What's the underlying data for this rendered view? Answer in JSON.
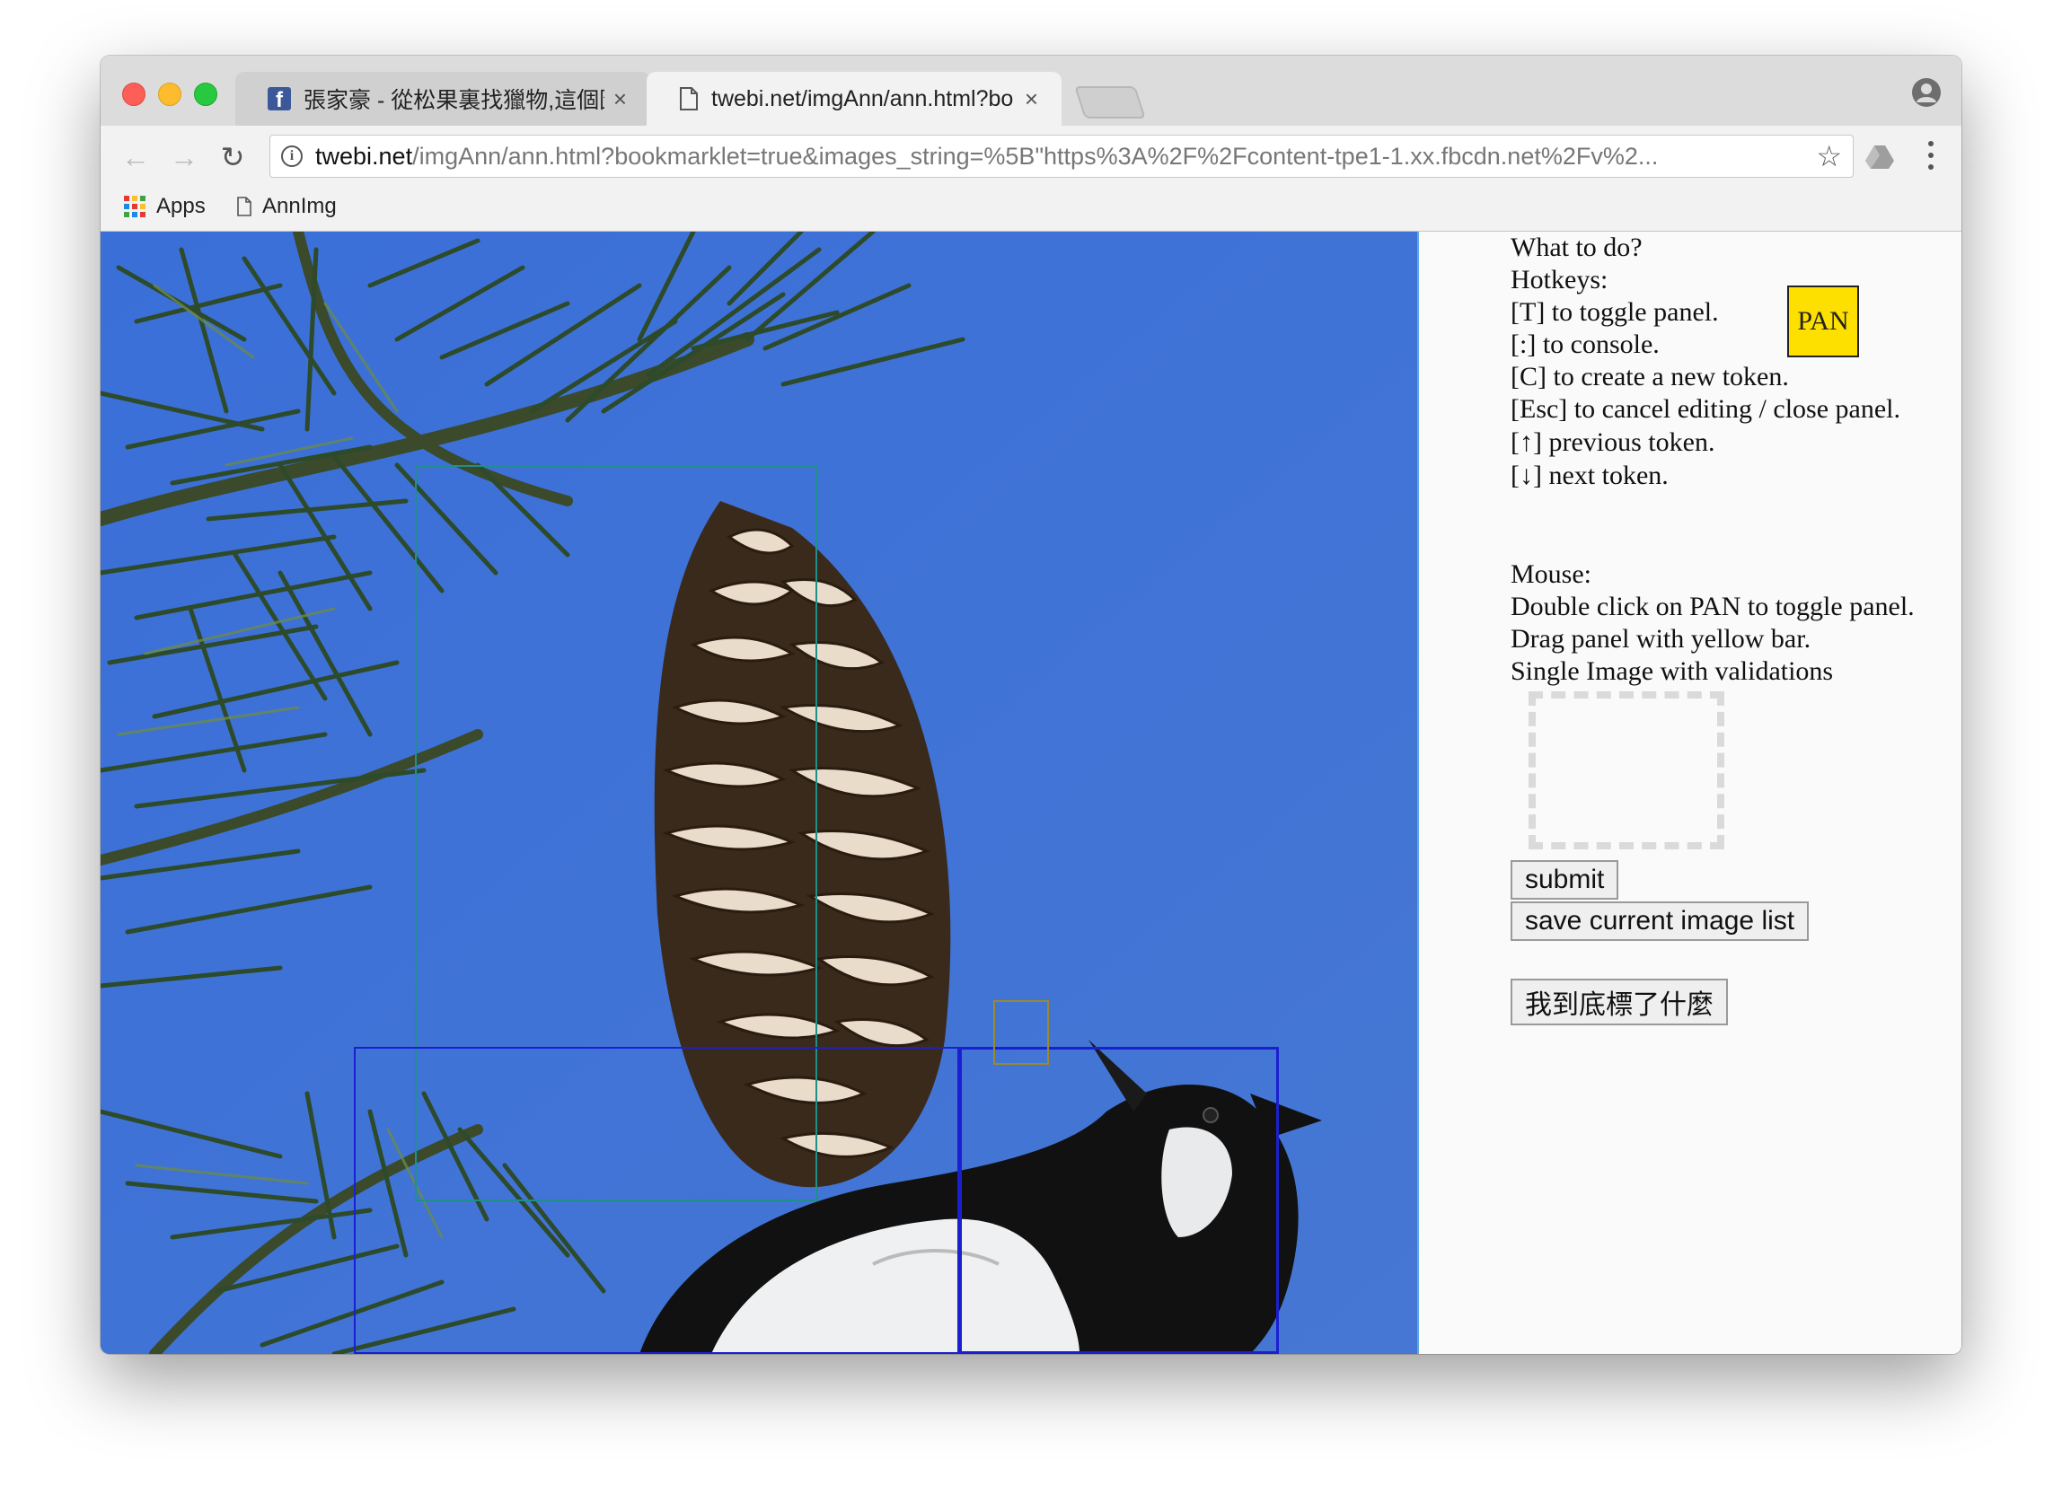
{
  "browser": {
    "tabs": [
      {
        "title": "張家豪 - 從松果裏找獵物,這個圖",
        "close": "×",
        "icon": "facebook-icon"
      },
      {
        "title": "twebi.net/imgAnn/ann.html?bo",
        "close": "×",
        "icon": "page-icon"
      }
    ],
    "url_host": "twebi.net",
    "url_path": "/imgAnn/ann.html?bookmarklet=true&images_string=%5B\"https%3A%2F%2Fcontent-tpe1-1.xx.fbcdn.net%2Fv%2...",
    "bookmarks": [
      {
        "label": "Apps",
        "icon": "apps-grid-icon"
      },
      {
        "label": "AnnImg",
        "icon": "page-icon"
      }
    ]
  },
  "panel": {
    "lines": [
      "What to do?",
      "Hotkeys:",
      "[T] to toggle panel.",
      "[:] to console.",
      "[C] to create a new token.",
      "[Esc] to cancel editing / close panel.",
      "[↑] previous token.",
      "[↓] next token.",
      "Mouse:",
      "Double click on PAN to toggle panel.",
      "Drag panel with yellow bar.",
      "Single Image with validations"
    ],
    "pan_label": "PAN",
    "buttons": {
      "submit": "submit",
      "save_list": "save current image list",
      "what_labeled": "我到底標了什麼"
    }
  },
  "colors": {
    "pan_yellow": "#fde000",
    "sky_blue": "#3f72d6",
    "bbox_teal": "#1f8f8a",
    "bbox_blue": "#1a20d0",
    "bbox_olive": "#9a8a2a"
  }
}
